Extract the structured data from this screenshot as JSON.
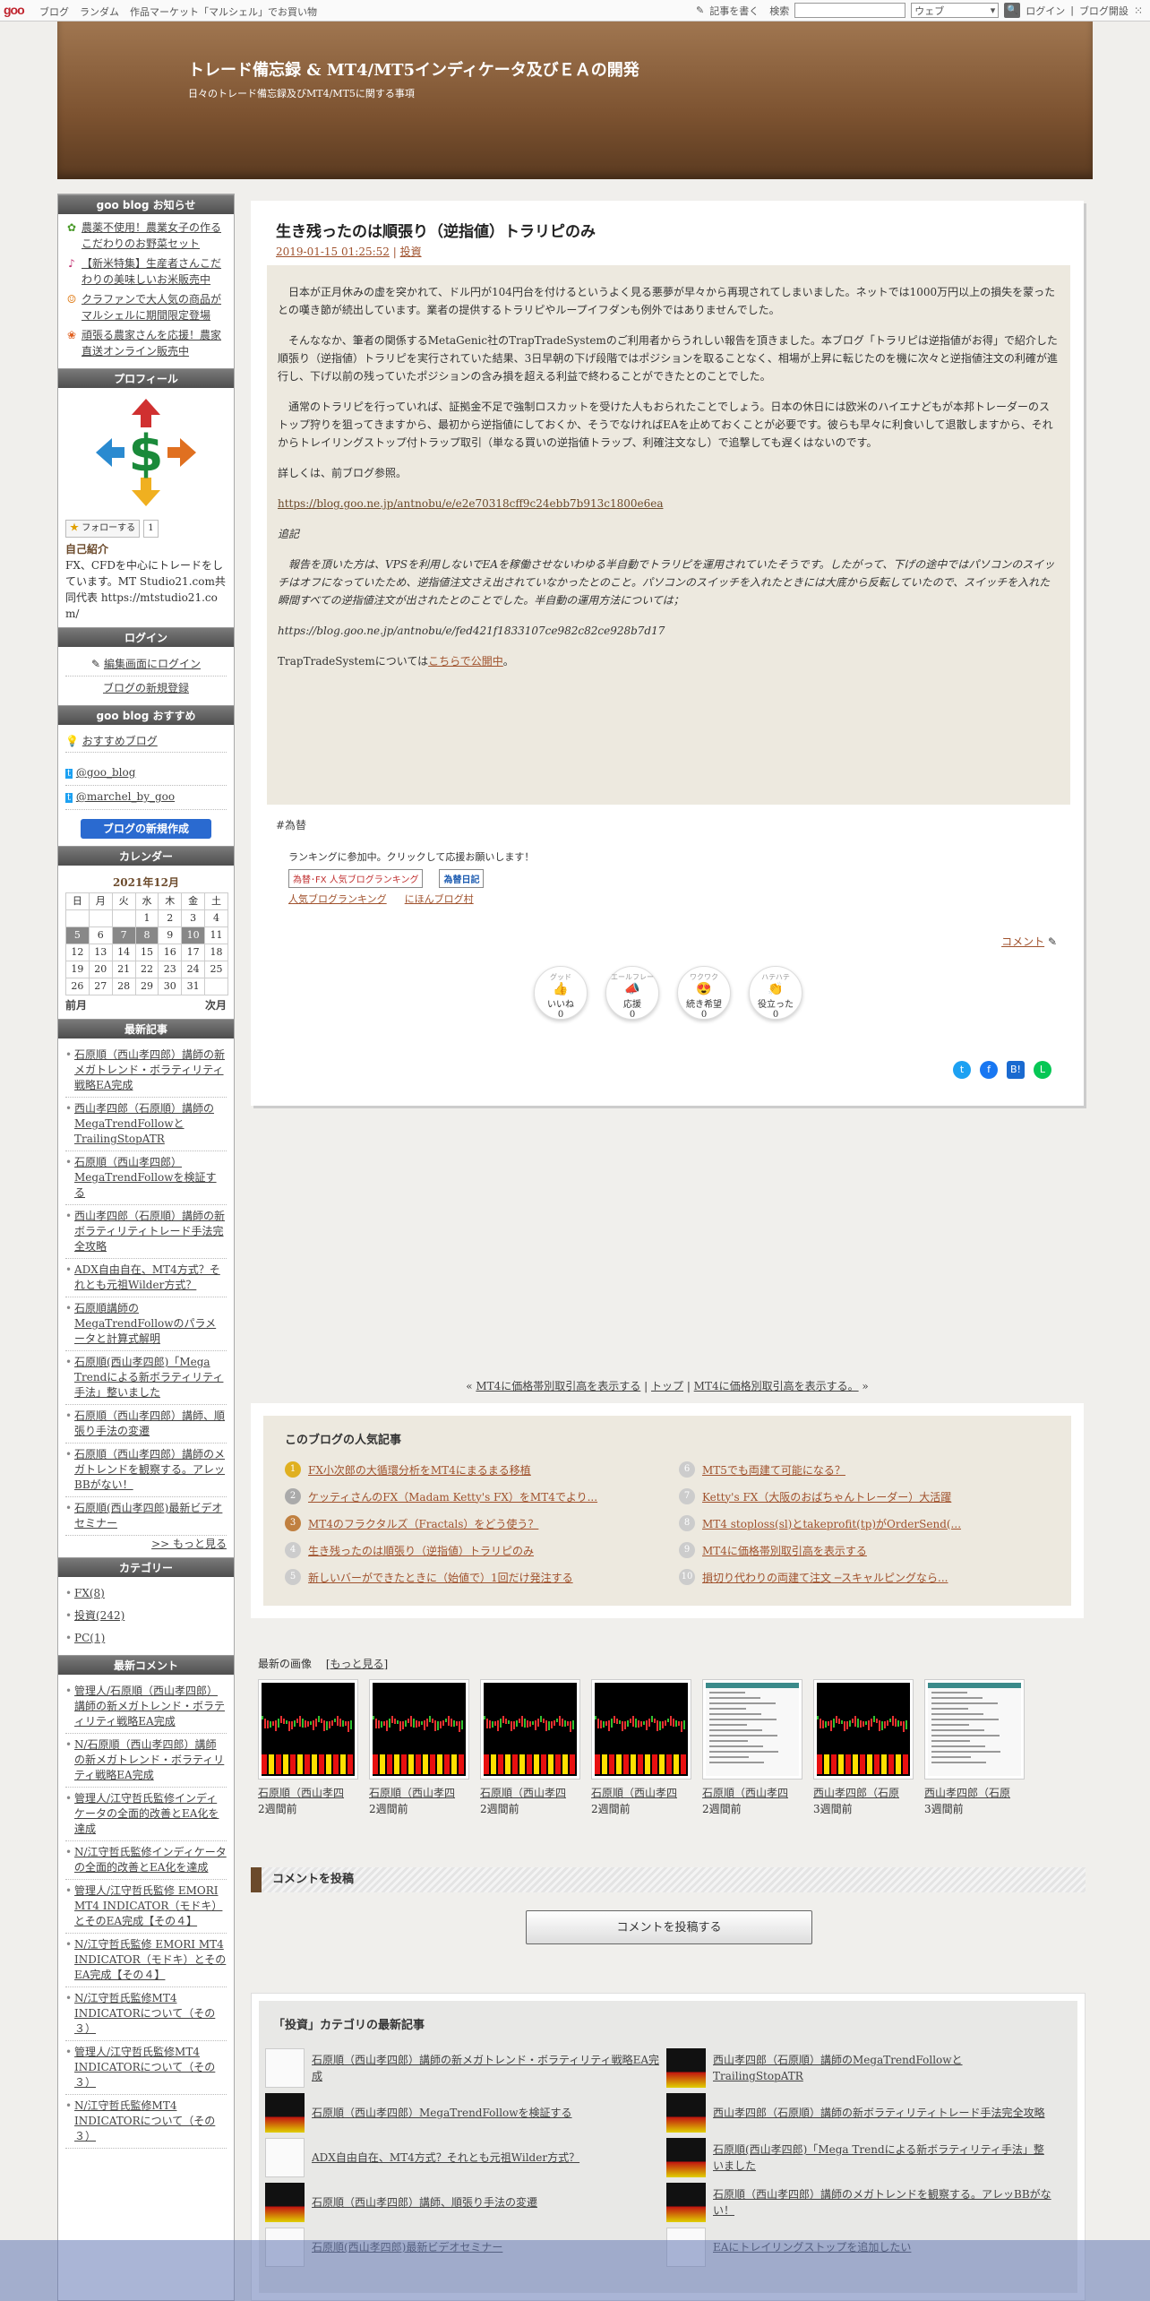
{
  "topbar": {
    "logo": "goo",
    "nav": [
      "ブログ",
      "ランダム",
      "作品マーケット「マルシェル」でお買い物"
    ],
    "write": "記事を書く",
    "search_label": "検索",
    "search_scope": "ウェブ",
    "login": "ログイン",
    "open_blog": "ブログ開設"
  },
  "header": {
    "title": "トレード備忘録 & MT4/MT5インディケータ及びＥＡの開発",
    "subtitle": "日々のトレード備忘録及びMT4/MT5に関する事項"
  },
  "sidebar": {
    "notice_title": "goo blog お知らせ",
    "notices": [
      "農薬不使用！農業女子の作るこだわりのお野菜セット",
      "【新米特集】生産者さんこだわりの美味しいお米販売中",
      "クラファンで大人気の商品がマルシェルに期間限定登場",
      "頑張る農家さんを応援！農家直送オンライン販売中"
    ],
    "profile_title": "プロフィール",
    "follow": "フォローする",
    "follow_count": "1",
    "intro_title": "自己紹介",
    "intro": "FX、CFDを中心にトレードをしています。MT Studio21.com共同代表 https://mtstudio21.com/",
    "login_title": "ログイン",
    "edit_login": "編集画面にログイン",
    "new_register": "ブログの新規登録",
    "recommend_title": "goo blog おすすめ",
    "recommend": "おすすめブログ",
    "tw1": "@goo_blog",
    "tw2": "@marchel_by_goo",
    "create": "ブログの新規作成",
    "calendar_title": "カレンダー",
    "month": "2021年12月",
    "weekdays": [
      "日",
      "月",
      "火",
      "水",
      "木",
      "金",
      "土"
    ],
    "prev": "前月",
    "next": "次月",
    "recent_title": "最新記事",
    "recent": [
      "石原順（西山孝四郎）講師の新メガトレンド・ボラティリティ戦略EA完成",
      "西山孝四郎（石原順）講師のMegaTrendFollowとTrailingStopATR",
      "石原順（西山孝四郎）MegaTrendFollowを検証する",
      "西山孝四郎（石原順）講師の新ボラティリティトレード手法完全攻略",
      "ADX自由自在、MT4方式？それとも元祖Wilder方式？",
      "石原順講師のMegaTrendFollowのパラメータと計算式解明",
      "石原順(西山孝四郎)「Mega Trendによる新ボラティリティ手法」整いました",
      "石原順（西山孝四郎）講師、順張り手法の変遷",
      "石原順（西山孝四郎）講師のメガトレンドを観察する。アレッBBがない！",
      "石原順(西山孝四郎)最新ビデオセミナー"
    ],
    "more": ">> もっと見る",
    "category_title": "カテゴリー",
    "categories": [
      "FX(8)",
      "投資(242)",
      "PC(1)"
    ],
    "comments_title": "最新コメント",
    "comments": [
      "管理人/石原順（西山孝四郎）講師の新メガトレンド・ボラティリティ戦略EA完成",
      "N/石原順（西山孝四郎）講師の新メガトレンド・ボラティリティ戦略EA完成",
      "管理人/江守哲氏監修インディケータの全面的改善とEA化を達成",
      "N/江守哲氏監修インディケータの全面的改善とEA化を達成",
      "管理人/江守哲氏監修 EMORI MT4 INDICATOR（モドキ）とそのEA完成【その４】",
      "N/江守哲氏監修 EMORI MT4 INDICATOR（モドキ）とそのEA完成【その４】",
      "N/江守哲氏監修MT4 INDICATORについて（その３）",
      "管理人/江守哲氏監修MT4 INDICATORについて（その３）",
      "N/江守哲氏監修MT4 INDICATORについて（その３）"
    ]
  },
  "article": {
    "title": "生き残ったのは順張り（逆指値）トラリピのみ",
    "date": "2019-01-15 01:25:52",
    "category": "投資",
    "p1": "日本が正月休みの虚を突かれて、ドル円が104円台を付けるというよく見る悪夢が早々から再現されてしまいました。ネットでは1000万円以上の損失を蒙ったとの嘆き節が続出しています。業者の提供するトラリピやループイフダンも例外ではありませんでした。",
    "p2": "そんななか、筆者の関係するMetaGenic社のTrapTradeSystemのご利用者からうれしい報告を頂きました。本ブログ「トラリピは逆指値がお得」で紹介した順張り（逆指値）トラリピを実行されていた結果、3日早朝の下げ段階ではポジションを取ることなく、相場が上昇に転じたのを機に次々と逆指値注文の利確が進行し、下げ以前の残っていたポジションの含み損を超える利益で終わることができたとのことでした。",
    "p3": "通常のトラリピを行っていれば、証拠金不足で強制ロスカットを受けた人もおられたことでしょう。日本の休日には欧米のハイエナどもが本邦トレーダーのストップ狩りを狙ってきますから、最初から逆指値にしておくか、そうでなければEAを止めておくことが必要です。彼らも早々に利食いして退散しますから、それからトレイリングストップ付トラップ取引（単なる買いの逆指値トラップ、利確注文なし）で追撃しても遅くはないのです。",
    "p4": "詳しくは、前ブログ参照。",
    "link1": "https://blog.goo.ne.jp/antnobu/e/e2e70318cff9c24ebb7b913c1800e6ea",
    "note": "追記",
    "p5": "報告を頂いた方は、VPSを利用しないでEAを稼働させないわゆる半自動でトラリピを運用されていたそうです。したがって、下げの途中ではパソコンのスイッチはオフになっていたため、逆指値注文さえ出されていなかったとのこと。パソコンのスイッチを入れたときには大底から反転していたので、スイッチを入れた瞬間すべての逆指値注文が出されたとのことでした。半自動の運用方法については；",
    "link2": "https://blog.goo.ne.jp/antnobu/e/fed421f1833107ce982c82ce928b7d17",
    "p6a": "TrapTradeSystemについては",
    "p6link": "こちらで公開中",
    "p6b": "。",
    "tag": "#為替",
    "rank_text": "ランキングに参加中。クリックして応援お願いします！",
    "badge1": "為替･FX 人気ブログランキング",
    "badge2": "為替日記",
    "rank1": "人気ブログランキング",
    "rank2": "にほんブログ村",
    "comment_link": "コメント",
    "reactions": [
      {
        "top": "グッド",
        "label": "いいね",
        "count": "0"
      },
      {
        "top": "エールフレー",
        "label": "応援",
        "count": "0"
      },
      {
        "top": "ワクワク",
        "label": "続き希望",
        "count": "0"
      },
      {
        "top": "ハテハテ",
        "label": "役立った",
        "count": "0"
      }
    ]
  },
  "pager": {
    "prev": "MT4に価格帯別取引高を表示する",
    "top": "トップ",
    "next": "MT4に価格別取引高を表示する。"
  },
  "popular": {
    "title": "このブログの人気記事",
    "items": [
      "FX小次郎の大循環分析をMT4にまるまる移植",
      "ケッティさんのFX（Madam Ketty's FX）をMT4でより...",
      "MT4のフラクタルズ（Fractals）をどう使う？",
      "生き残ったのは順張り（逆指値）トラリピのみ",
      "新しいバーができたときに（始値で）1回だけ発注する",
      "MT5でも両建て可能になる？",
      "Ketty's FX（大阪のおばちゃんトレーダー）大活躍",
      "MT4 stoploss(sl)とtakeprofit(tp)がOrderSend(...",
      "MT4に価格帯別取引高を表示する",
      "損切り代わりの両建て注文 ─スキャルピングなら..."
    ]
  },
  "images": {
    "title": "最新の画像",
    "more": "もっと見る",
    "items": [
      {
        "cap": "石原順（西山孝四",
        "when": "2週間前"
      },
      {
        "cap": "石原順（西山孝四",
        "when": "2週間前"
      },
      {
        "cap": "石原順（西山孝四",
        "when": "2週間前"
      },
      {
        "cap": "石原順（西山孝四",
        "when": "2週間前"
      },
      {
        "cap": "石原順（西山孝四",
        "when": "2週間前"
      },
      {
        "cap": "西山孝四郎（石原",
        "when": "3週間前"
      },
      {
        "cap": "西山孝四郎（石原",
        "when": "3週間前"
      }
    ]
  },
  "comment_post": {
    "heading": "コメントを投稿",
    "button": "コメントを投稿する"
  },
  "category_recent": {
    "title": "「投資」カテゴリの最新記事",
    "left": [
      "石原順（西山孝四郎）講師の新メガトレンド・ボラティリティ戦略EA完成",
      "石原順（西山孝四郎）MegaTrendFollowを検証する",
      "ADX自由自在、MT4方式？それとも元祖Wilder方式？",
      "石原順（西山孝四郎）講師、順張り手法の変遷",
      "石原順(西山孝四郎)最新ビデオセミナー"
    ],
    "right": [
      "西山孝四郎（石原順）講師のMegaTrendFollowとTrailingStopATR",
      "西山孝四郎（石原順）講師の新ボラティリティトレード手法完全攻略",
      "石原順(西山孝四郎)「Mega Trendによる新ボラティリティ手法」整いました",
      "石原順（西山孝四郎）講師のメガトレンドを観察する。アレッBBがない！",
      "EAにトレイリングストップを追加したい"
    ]
  }
}
